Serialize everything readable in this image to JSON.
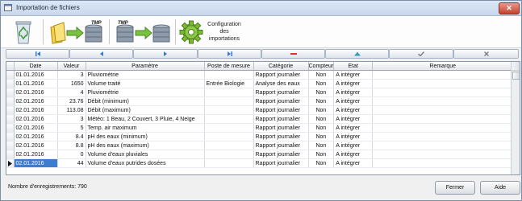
{
  "window": {
    "title": "Importation de fichiers",
    "close_label": "✕"
  },
  "toolbar": {
    "tmp_label_1": "TMP",
    "tmp_label_2": "TMP",
    "config_label": "Configuration des importations"
  },
  "table": {
    "columns": [
      "Date",
      "Valeur",
      "Paramètre",
      "Poste de mesure",
      "Catégorie",
      "Compteur",
      "Etat",
      "Remarque"
    ],
    "rows": [
      [
        "01.01.2016",
        "3",
        "Pluviométrie",
        "",
        "Rapport journalier",
        "Non",
        "A intégrer",
        ""
      ],
      [
        "01.01.2016",
        "1650",
        "Volume traité",
        "Entrée Biologie",
        "Analyse des eaux",
        "Non",
        "A intégrer",
        ""
      ],
      [
        "02.01.2016",
        "4",
        "Pluviométrie",
        "",
        "Rapport journalier",
        "Non",
        "A intégrer",
        ""
      ],
      [
        "02.01.2016",
        "23.76",
        "Débit (minimum)",
        "",
        "Rapport journalier",
        "Non",
        "A intégrer",
        ""
      ],
      [
        "02.01.2016",
        "113.08",
        "Débit (maximum)",
        "",
        "Rapport journalier",
        "Non",
        "A intégrer",
        ""
      ],
      [
        "02.01.2016",
        "3",
        "Météo: 1 Beau, 2 Couvert, 3 Pluie, 4 Neige",
        "",
        "Rapport journalier",
        "Non",
        "A intégrer",
        ""
      ],
      [
        "02.01.2016",
        "5",
        "Temp. air maximum",
        "",
        "Rapport journalier",
        "Non",
        "A intégrer",
        ""
      ],
      [
        "02.01.2016",
        "8.4",
        "pH des eaux (minimum)",
        "",
        "Rapport journalier",
        "Non",
        "A intégrer",
        ""
      ],
      [
        "02.01.2016",
        "8.8",
        "pH des eaux (maximum)",
        "",
        "Rapport journalier",
        "Non",
        "A intégrer",
        ""
      ],
      [
        "02.01.2016",
        "0",
        "Volume d'eaux pluviales",
        "",
        "Rapport journalier",
        "Non",
        "A intégrer",
        ""
      ],
      [
        "02.01.2016",
        "44",
        "Volume d'eaux putrides dosées",
        "",
        "Rapport journalier",
        "Non",
        "A intégrer",
        ""
      ]
    ],
    "selected_row": 10
  },
  "status": {
    "record_count": "Nombre d'enregistrements: 790"
  },
  "buttons": {
    "close": "Fermer",
    "help": "Aide"
  },
  "colors": {
    "selection": "#3d7ccf",
    "accent": "#6aa82c"
  }
}
